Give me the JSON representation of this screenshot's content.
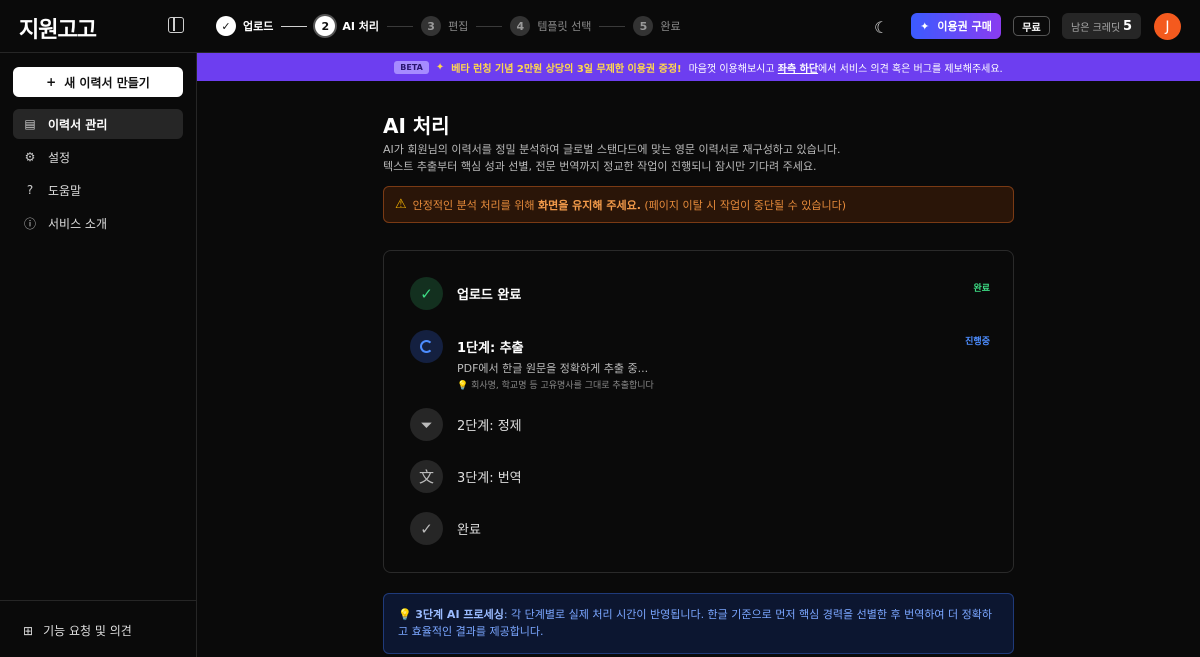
{
  "header": {
    "logo": "지원고고",
    "steps": [
      {
        "num": "✓",
        "label": "업로드",
        "state": "done"
      },
      {
        "num": "2",
        "label": "AI 처리",
        "state": "active"
      },
      {
        "num": "3",
        "label": "편집",
        "state": "pending"
      },
      {
        "num": "4",
        "label": "템플릿 선택",
        "state": "pending"
      },
      {
        "num": "5",
        "label": "완료",
        "state": "pending"
      }
    ],
    "buy_label": "이용권 구매",
    "plan_badge": "무료",
    "credits_label": "남은 크레딧",
    "credits_value": "5",
    "avatar_initial": "J"
  },
  "sidebar": {
    "new_button": "새 이력서 만들기",
    "items": [
      {
        "label": "이력서 관리",
        "icon": "document-icon",
        "active": true
      },
      {
        "label": "설정",
        "icon": "gear-icon",
        "active": false
      },
      {
        "label": "도움말",
        "icon": "help-icon",
        "active": false
      },
      {
        "label": "서비스 소개",
        "icon": "info-icon",
        "active": false
      }
    ],
    "feedback": "기능 요청 및 의견"
  },
  "banner": {
    "badge": "BETA",
    "highlight": "베타 런칭 기념 2만원 상당의 3일 무제한 이용권 증정!",
    "text_1": "마음껏 이용해보시고",
    "link": "좌측 하단",
    "text_2": "에서 서비스 의견 혹은 버그를 제보해주세요."
  },
  "main": {
    "title": "AI 처리",
    "desc_1": "AI가 회원님의 이력서를 정밀 분석하여 글로벌 스탠다드에 맞는 영문 이력서로 재구성하고 있습니다.",
    "desc_2": "텍스트 추출부터 핵심 성과 선별, 전문 번역까지 정교한 작업이 진행되니 잠시만 기다려 주세요.",
    "warning_1": "안정적인 분석 처리를 위해",
    "warning_bold": "화면을 유지해 주세요.",
    "warning_2": "(페이지 이탈 시 작업이 중단될 수 있습니다)",
    "processes": [
      {
        "title": "업로드 완료",
        "status": "완료",
        "state": "done",
        "icon": "check-circle-icon"
      },
      {
        "title": "1단계: 추출",
        "status": "진행중",
        "state": "running",
        "icon": "spinner-icon",
        "sub": "PDF에서 한글 원문을 정확하게 추출 중...",
        "hint": "💡 회사명, 학교명 등 고유명사를 그대로 추출합니다"
      },
      {
        "title": "2단계: 정제",
        "state": "idle",
        "icon": "filter-icon"
      },
      {
        "title": "3단계: 번역",
        "state": "idle",
        "icon": "translate-icon"
      },
      {
        "title": "완료",
        "state": "idle",
        "icon": "check-circle-icon"
      }
    ],
    "info_bold": "3단계 AI 프로세싱",
    "info_text": ": 각 단계별로 실제 처리 시간이 반영됩니다. 한글 기준으로 먼저 핵심 경력을 선별한 후 번역하여 더 정확하고 효율적인 결과를 제공합니다."
  }
}
